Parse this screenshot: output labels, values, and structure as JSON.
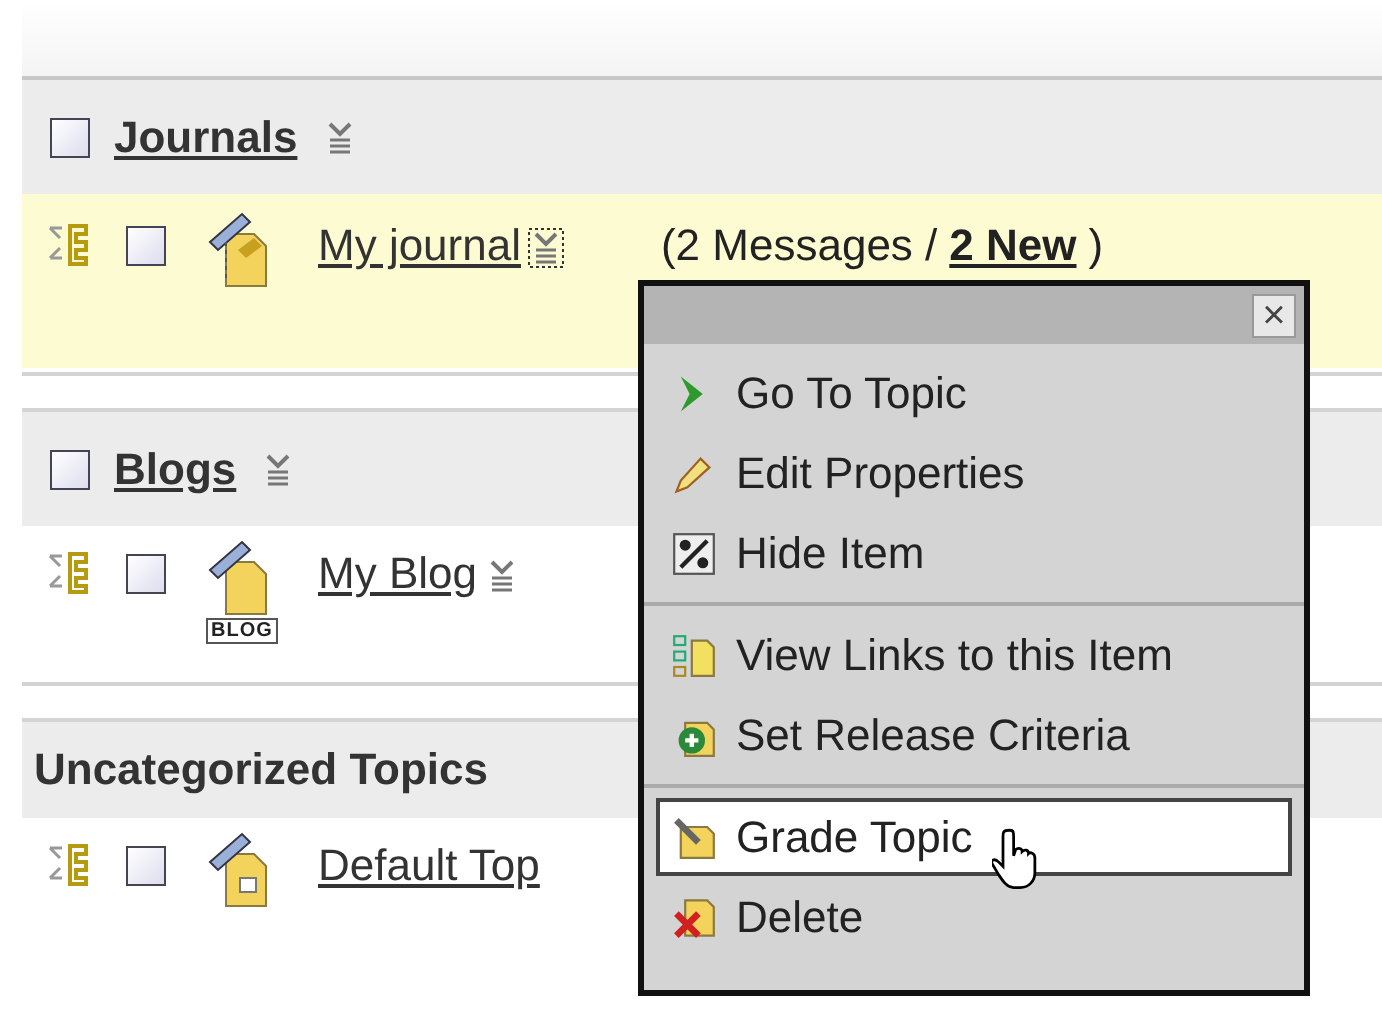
{
  "sections": [
    {
      "title": "Journals",
      "linked": true,
      "checkbox": {
        "checked": false
      },
      "items": [
        {
          "title": "My journal",
          "kind": "journal",
          "checkbox": {
            "checked": false
          },
          "highlighted": true,
          "focused": true,
          "messages": "(2 Messages /",
          "new_count": "2 New",
          "close_paren": ")"
        }
      ]
    },
    {
      "title": "Blogs",
      "linked": true,
      "checkbox": {
        "checked": false
      },
      "items": [
        {
          "title": "My Blog",
          "kind": "blog",
          "checkbox": {
            "checked": false
          },
          "badge": "BLOG",
          "highlighted": false,
          "focused": false
        }
      ]
    },
    {
      "title": "Uncategorized Topics",
      "linked": false,
      "items": [
        {
          "title": "Default Top",
          "kind": "topic",
          "checkbox": {
            "checked": false
          },
          "highlighted": false
        }
      ]
    }
  ],
  "context_menu": {
    "close": "×",
    "groups": [
      [
        {
          "label": "Go To Topic",
          "kind": "go",
          "selected": false
        },
        {
          "label": "Edit Properties",
          "kind": "edit",
          "selected": false
        },
        {
          "label": "Hide Item",
          "kind": "hide",
          "selected": false
        }
      ],
      [
        {
          "label": "View Links to this Item",
          "kind": "links",
          "selected": false
        },
        {
          "label": "Set Release Criteria",
          "kind": "release",
          "selected": false
        }
      ],
      [
        {
          "label": "Grade Topic",
          "kind": "grade",
          "selected": true
        },
        {
          "label": "Delete",
          "kind": "delete",
          "selected": false
        }
      ]
    ]
  }
}
